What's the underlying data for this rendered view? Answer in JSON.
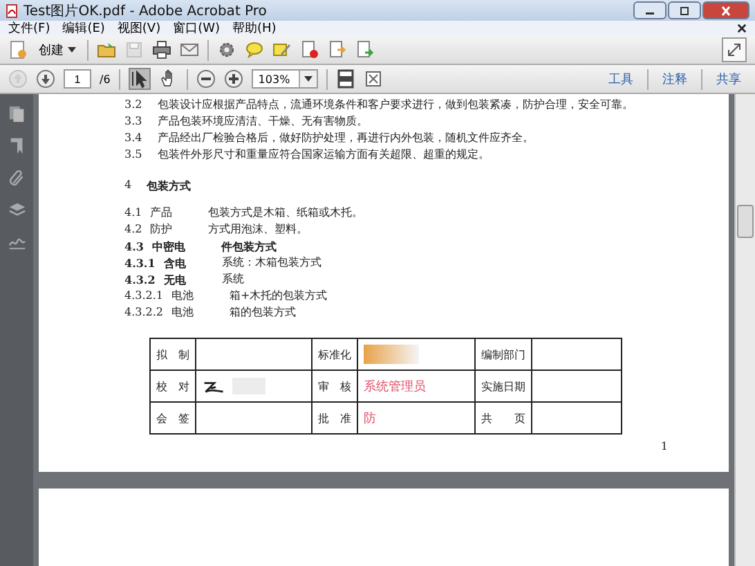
{
  "window": {
    "title": "Test图片OK.pdf - Adobe Acrobat Pro"
  },
  "menu": [
    "文件(F)",
    "编辑(E)",
    "视图(V)",
    "窗口(W)",
    "帮助(H)"
  ],
  "toolbar": {
    "create": "创建",
    "page": "1",
    "page_total": "/6",
    "zoom": "103%",
    "panels": [
      "工具",
      "注释",
      "共享"
    ]
  },
  "lines": [
    {
      "num": "3.2",
      "parts": [
        {
          "text": "包装设计应根据产品特点，流通环境条件和客户要求进行，做到包装紧凑，防护合理，安全可靠。",
          "bold": false
        }
      ]
    },
    {
      "num": "3.3",
      "parts": [
        {
          "text": "产品包装环境应清洁、干燥、无有害物质。",
          "bold": false
        }
      ]
    },
    {
      "num": "3.4",
      "parts": [
        {
          "text": "产品经出厂检验合格后，做好防护处理，再进行内外包装，随机文件应齐全。",
          "bold": false
        }
      ]
    },
    {
      "num": "3.5",
      "parts": [
        {
          "text": "包装件外形尺寸和重量应符合国家运输方面有关超限、超重的规定。",
          "bold": false
        }
      ]
    }
  ],
  "heading": {
    "num": "4",
    "text": "包装方式"
  },
  "items": [
    {
      "num": "4.1",
      "parts": [
        {
          "text": "产品",
          "bold": false
        },
        {
          "text": "包装方式是木箱、纸箱或木托。",
          "bold": false
        }
      ]
    },
    {
      "num": "4.2",
      "parts": [
        {
          "text": "防护",
          "bold": false
        },
        {
          "text": "方式用泡沫、塑料。",
          "bold": false
        }
      ]
    },
    {
      "num": "4.3",
      "parts": [
        {
          "text": "中密电",
          "bold": true
        },
        {
          "text": "件包装方式",
          "bold": true
        }
      ]
    },
    {
      "num": "4.3.1",
      "parts": [
        {
          "text": "含电",
          "bold": true
        },
        {
          "text": "系统：木箱包装方式",
          "bold": false
        }
      ]
    },
    {
      "num": "4.3.2",
      "parts": [
        {
          "text": "无电",
          "bold": true
        },
        {
          "text": "系统",
          "bold": false
        }
      ]
    },
    {
      "num": "4.3.2.1",
      "parts": [
        {
          "text": "电池",
          "bold": false
        },
        {
          "text": "箱+木托的包装方式",
          "bold": false
        }
      ]
    },
    {
      "num": "4.3.2.2",
      "parts": [
        {
          "text": "电池",
          "bold": false
        },
        {
          "text": "箱的包装方式",
          "bold": false
        }
      ]
    }
  ],
  "table": {
    "rows": [
      {
        "label": "拟　制",
        "label_2": "标准化",
        "label_3": "编制部门"
      },
      {
        "label": "校　对",
        "label_2": "审　核",
        "stamp": "系统管理员",
        "label_3": "实施日期"
      },
      {
        "label": "会　签",
        "label_2": "批　准",
        "stamp": "防",
        "label_3": "共　　页"
      }
    ]
  },
  "page_number": "1"
}
